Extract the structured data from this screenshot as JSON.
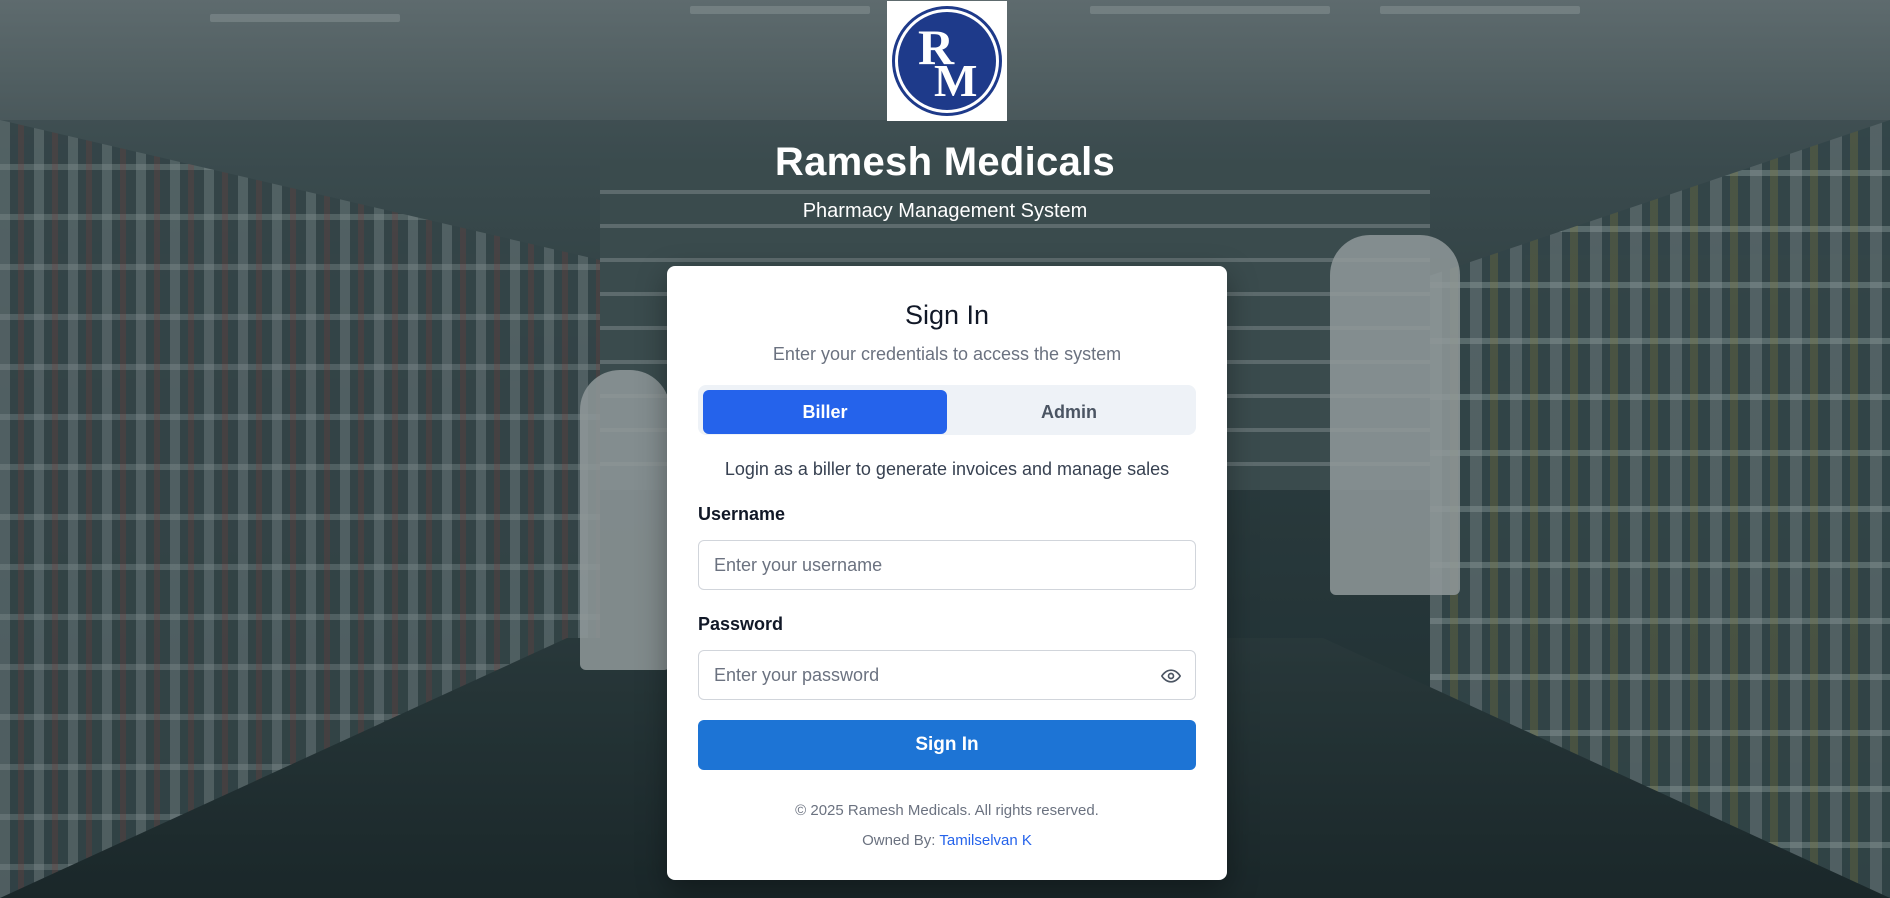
{
  "brand": {
    "logo_letters": "RM",
    "title": "Ramesh Medicals",
    "subtitle": "Pharmacy Management System"
  },
  "signin": {
    "title": "Sign In",
    "description": "Enter your credentials to access the system",
    "roles": [
      {
        "label": "Biller",
        "selected": true
      },
      {
        "label": "Admin",
        "selected": false
      }
    ],
    "role_hint": "Login as a biller to generate invoices and manage sales",
    "username": {
      "label": "Username",
      "placeholder": "Enter your username",
      "value": ""
    },
    "password": {
      "label": "Password",
      "placeholder": "Enter your password",
      "value": ""
    },
    "submit_label": "Sign In"
  },
  "footer": {
    "copyright": "© 2025 Ramesh Medicals. All rights reserved.",
    "owner_prefix": "Owned By:",
    "owner_name": "Tamilselvan K"
  },
  "icons": {
    "password_toggle": "eye-icon"
  },
  "colors": {
    "primary": "#2563eb",
    "submit": "#1d74d5",
    "logo_blue": "#1e3a8a"
  }
}
